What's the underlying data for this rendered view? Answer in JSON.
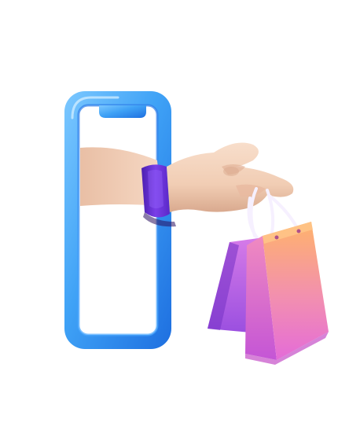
{
  "illustration": {
    "subject": "phone-shopping-hand-with-bags",
    "colors": {
      "phone_frame": "#3FA2F6",
      "phone_frame_light": "#7CC8FF",
      "phone_frame_dark": "#1E6FE0",
      "skin": "#F3D2BC",
      "skin_shadow": "#D9A98E",
      "wristband": "#6B2FD6",
      "wristband_highlight": "#9C6BFF",
      "bag_front_top": "#FFB36B",
      "bag_front_bottom": "#E46BD8",
      "bag_back": "#B86BE8",
      "bag_handle": "#F6F0FF",
      "background": "#FFFFFF"
    }
  }
}
